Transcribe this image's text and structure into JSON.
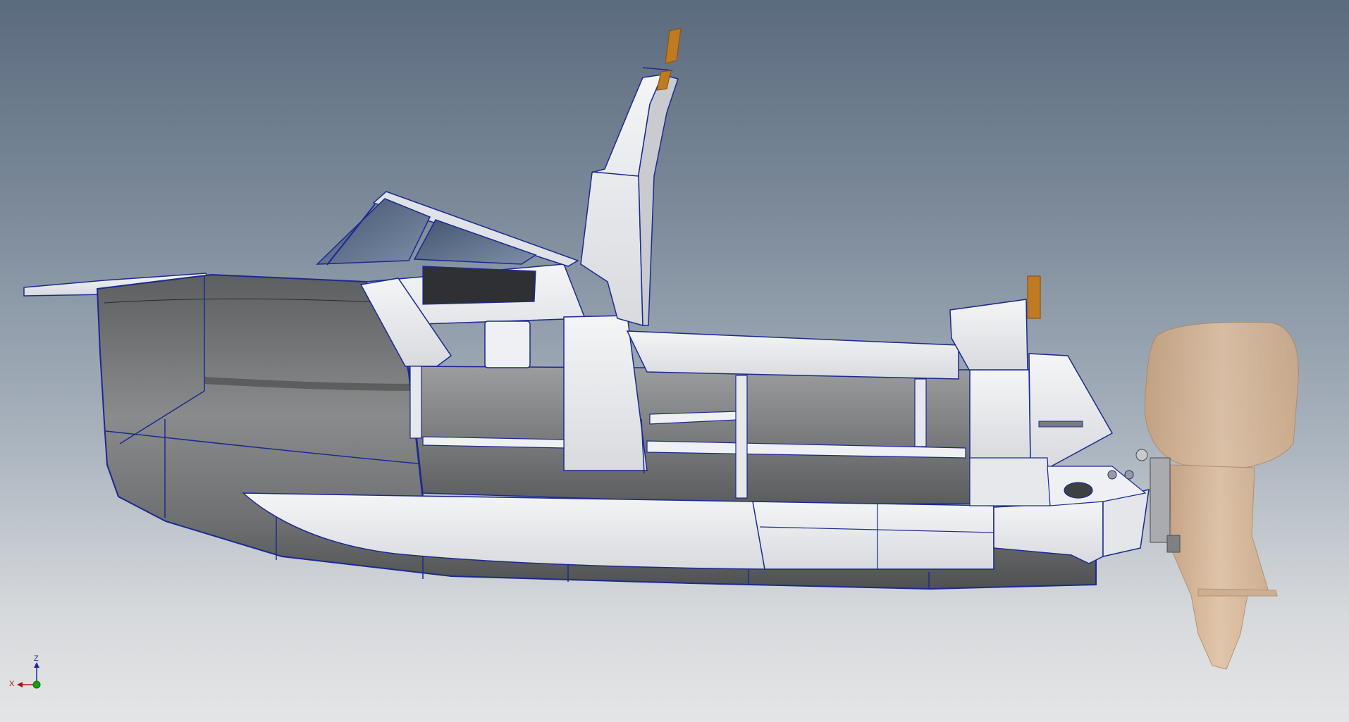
{
  "viewport": {
    "background_top": "#5b6b7e",
    "background_bottom": "#e4e5e6"
  },
  "model": {
    "subject": "boat-side-view",
    "hull_color": "#6f7072",
    "deck_color": "#eceef1",
    "edge_color": "#1b2a8f",
    "glass_color": "#566a86",
    "handle_color": "#c07a22",
    "outboard_color": "#d9b38e"
  },
  "triad": {
    "z_label": "Z",
    "x_label": "X",
    "z_color": "#1a2a9a",
    "x_color": "#b01010",
    "y_color": "#13a013"
  }
}
